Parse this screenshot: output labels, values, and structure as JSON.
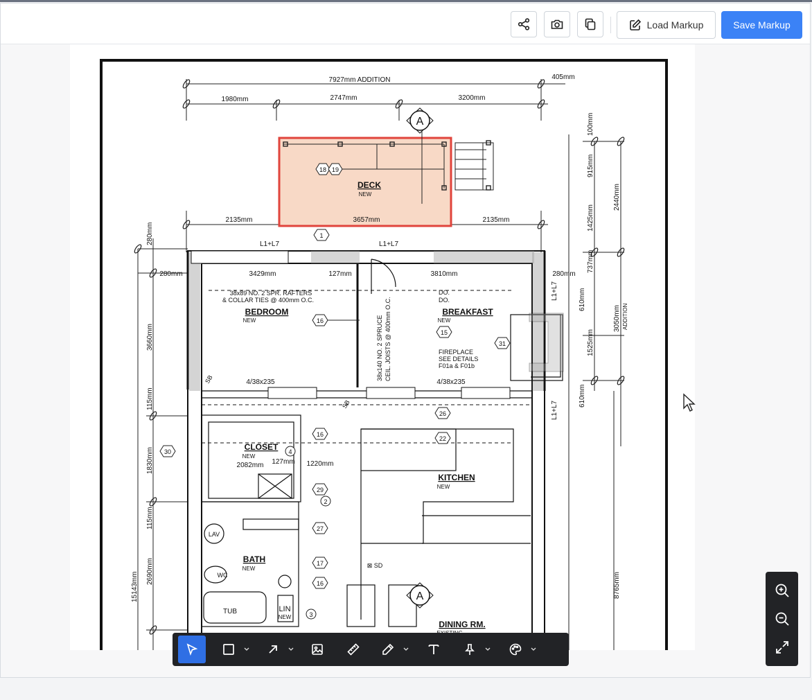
{
  "header": {
    "share_icon": "share-icon",
    "camera_icon": "camera-icon",
    "copy_icon": "copy-icon",
    "load_label": "Load Markup",
    "save_label": "Save Markup"
  },
  "colors": {
    "accent": "#3b82f6",
    "toolbar_bg": "#222326",
    "markup_fill": "#f8d9c6",
    "markup_stroke": "#e0443c"
  },
  "drawing": {
    "dim_total": "7927mm  ADDITION",
    "dim_405": "405mm",
    "dim_1980": "1980mm",
    "dim_2747": "2747mm",
    "dim_3200": "3200mm",
    "section_a": "A",
    "deck_title": "DECK",
    "deck_sub": "NEW",
    "tag_18": "18",
    "tag_19": "19",
    "dim_2135_left": "2135mm",
    "dim_3657": "3657mm",
    "dim_2135_right": "2135mm",
    "tag_1": "1",
    "l1l7_a": "L1+L7",
    "l1l7_b": "L1+L7",
    "dim_3429": "3429mm",
    "dim_127": "127mm",
    "dim_3810": "3810mm",
    "dim_280_left": "280mm",
    "dim_280_right": "280mm",
    "rafters_1": "38x89 NO. 2 SPR. RAFTERS",
    "rafters_2": "& COLLAR TIES @ 400mm O.C.",
    "bedroom_title": "BEDROOM",
    "bedroom_sub": "NEW",
    "tag_16": "16",
    "do_1": "DO.",
    "do_2": "DO.",
    "breakfast_title": "BREAKFAST",
    "breakfast_sub": "NEW",
    "tag_15": "15",
    "tag_31": "31",
    "fireplace_1": "FIREPLACE",
    "fireplace_2": "SEE DETAILS",
    "fireplace_3": "F01a & F01b",
    "joists_1": "38x140 NO. 2 SPRUCE",
    "joists_2": "CEIL. JOISTS @ 400mm O.C.",
    "beam_left": "4/38x235",
    "beam_right": "4/38x235",
    "sb_1": "SB",
    "sb_2": "SB",
    "tag_26": "26",
    "tag_22": "22",
    "closet_title": "CLOSET",
    "closet_sub": "NEW",
    "closet_dim": "2082mm",
    "tag_4": "4",
    "dim_127b": "127mm",
    "dim_1220": "1220mm",
    "tag_30": "30",
    "kitchen_title": "KITCHEN",
    "kitchen_sub": "NEW",
    "tag_29": "29",
    "tag_2": "2",
    "tag_27": "27",
    "lav": "LAV",
    "bath_title": "BATH",
    "bath_sub": "NEW",
    "tag_17": "17",
    "wc": "WC",
    "tag_16b": "16",
    "tub": "TUB",
    "lin_1": "LIN",
    "lin_2": "NEW",
    "tag_3": "3",
    "sd": "⊠ SD",
    "section_a2": "A",
    "dining_title": "DINING RM.",
    "dining_sub": "EXISTING",
    "v_100": "100mm",
    "v_915": "915mm",
    "v_2440": "2440mm",
    "v_1425": "1425mm",
    "v_737": "737mm",
    "v_610a": "610mm",
    "v_3050": "3050mm",
    "v_addition": "ADDITION",
    "v_1525": "1525mm",
    "v_610b": "610mm",
    "v_8765": "8765mm",
    "v_l1l7_a": "L1+L7",
    "v_l1l7_b": "L1+L7",
    "v_280": "280mm",
    "v_3660": "3660mm",
    "v_115a": "115mm",
    "v_1830": "1830mm",
    "v_115b": "115mm",
    "v_2690": "2690mm",
    "v_15143": "15143mm"
  },
  "toolbar": {
    "tools": [
      "select-tool",
      "rectangle-tool",
      "arrow-tool",
      "image-tool",
      "measure-tool",
      "pencil-tool",
      "text-tool",
      "pin-tool",
      "color-tool"
    ],
    "active": "select-tool"
  },
  "zoom": {
    "zoom_in_icon": "zoom-in-icon",
    "zoom_out_icon": "zoom-out-icon",
    "fit_icon": "fit-screen-icon"
  }
}
